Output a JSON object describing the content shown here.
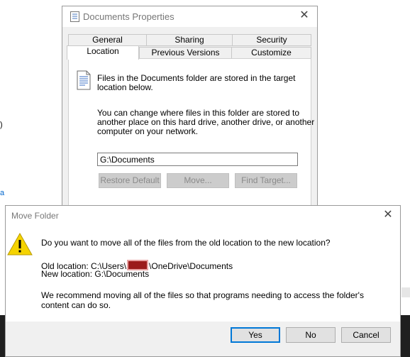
{
  "background": {
    "left_fragment": ")",
    "left_link": "a"
  },
  "properties": {
    "title": "Documents Properties",
    "tabs_row1": [
      "General",
      "Sharing",
      "Security"
    ],
    "tabs_row2": [
      "Location",
      "Previous Versions",
      "Customize"
    ],
    "active_tab": "Location",
    "info_line1": "Files in the Documents folder are stored in the target",
    "info_line2": "location below.",
    "change_line1": "You can change where files in this folder are stored to",
    "change_line2": "another place on this hard drive, another drive, or another",
    "change_line3": "computer on your network.",
    "path_value": "G:\\Documents",
    "buttons": {
      "restore": "Restore Default",
      "move": "Move...",
      "find": "Find Target..."
    }
  },
  "move_dialog": {
    "title": "Move Folder",
    "question": "Do you want to move all of the files from the old location to the new location?",
    "old_prefix": "Old location: C:\\Users\\",
    "old_suffix": "\\OneDrive\\Documents",
    "new_location": "New location: G:\\Documents",
    "recommend_line1": "We recommend moving all of the files so that programs needing to access the folder's",
    "recommend_line2": "content can do so.",
    "buttons": {
      "yes": "Yes",
      "no": "No",
      "cancel": "Cancel"
    }
  },
  "icons": {
    "props_title": "folder-properties-icon",
    "doc": "document-icon",
    "warning": "warning-icon",
    "close": "close-icon"
  },
  "colors": {
    "accent": "#0078d7",
    "warning": "#f5d300",
    "redaction": "#9b1c1c"
  }
}
